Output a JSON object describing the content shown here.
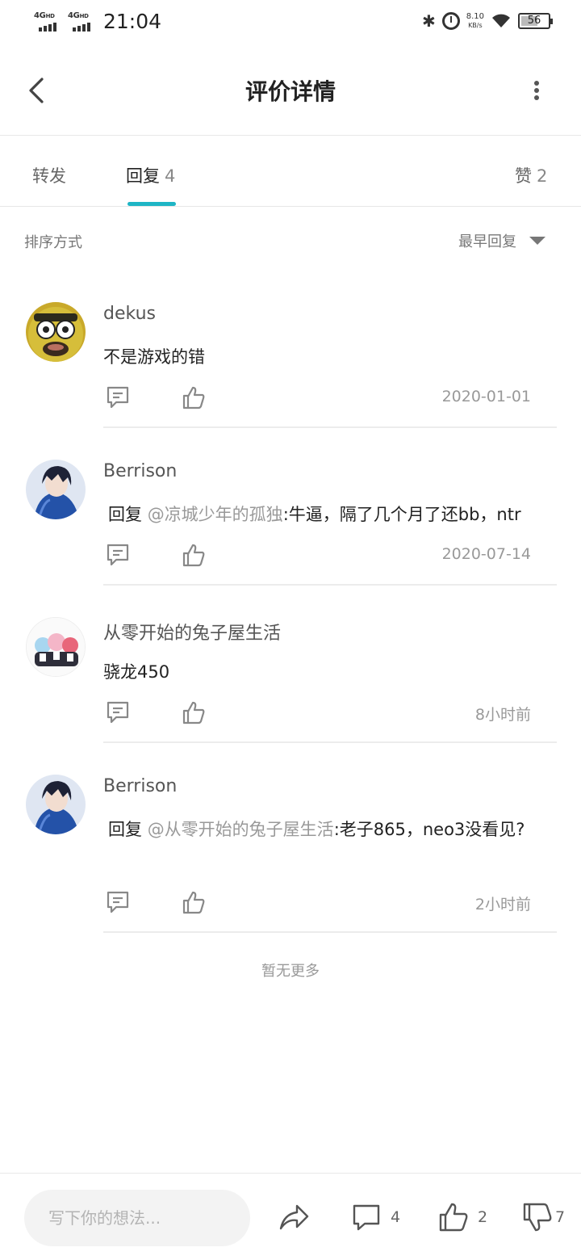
{
  "status_bar": {
    "network_1": "4G",
    "network_2": "4G",
    "hd_label": "HD",
    "time": "21:04",
    "speed_value": "8.10",
    "speed_unit": "KB/s",
    "battery": "56"
  },
  "header": {
    "title": "评价详情"
  },
  "tabs": [
    {
      "label": "转发",
      "count": ""
    },
    {
      "label": "回复",
      "count": "4"
    },
    {
      "label": "赞",
      "count": "2"
    }
  ],
  "active_tab": "回复",
  "accent_color": "#1eb5c5",
  "sort": {
    "label": "排序方式",
    "selected": "最早回复"
  },
  "replies": [
    {
      "username": "dekus",
      "reply_prefix": "",
      "mention": "",
      "text": "不是游戏的错",
      "time": "2020-01-01"
    },
    {
      "username": "Berrison",
      "reply_prefix": "回复",
      "mention": "@凉城少年的孤独",
      "text": ":牛逼，隔了几个月了还bb，ntr",
      "time": "2020-07-14"
    },
    {
      "username": "从零开始的兔子屋生活",
      "reply_prefix": "",
      "mention": "",
      "text": "骁龙450",
      "time": "8小时前"
    },
    {
      "username": "Berrison",
      "reply_prefix": "回复",
      "mention": "@从零开始的兔子屋生活",
      "text": ":老子865，neo3没看见?",
      "time": "2小时前"
    }
  ],
  "no_more": "暂无更多",
  "bottom_bar": {
    "input_placeholder": "写下你的想法...",
    "comment_count": "4",
    "like_count": "2",
    "dislike_count": "7"
  }
}
